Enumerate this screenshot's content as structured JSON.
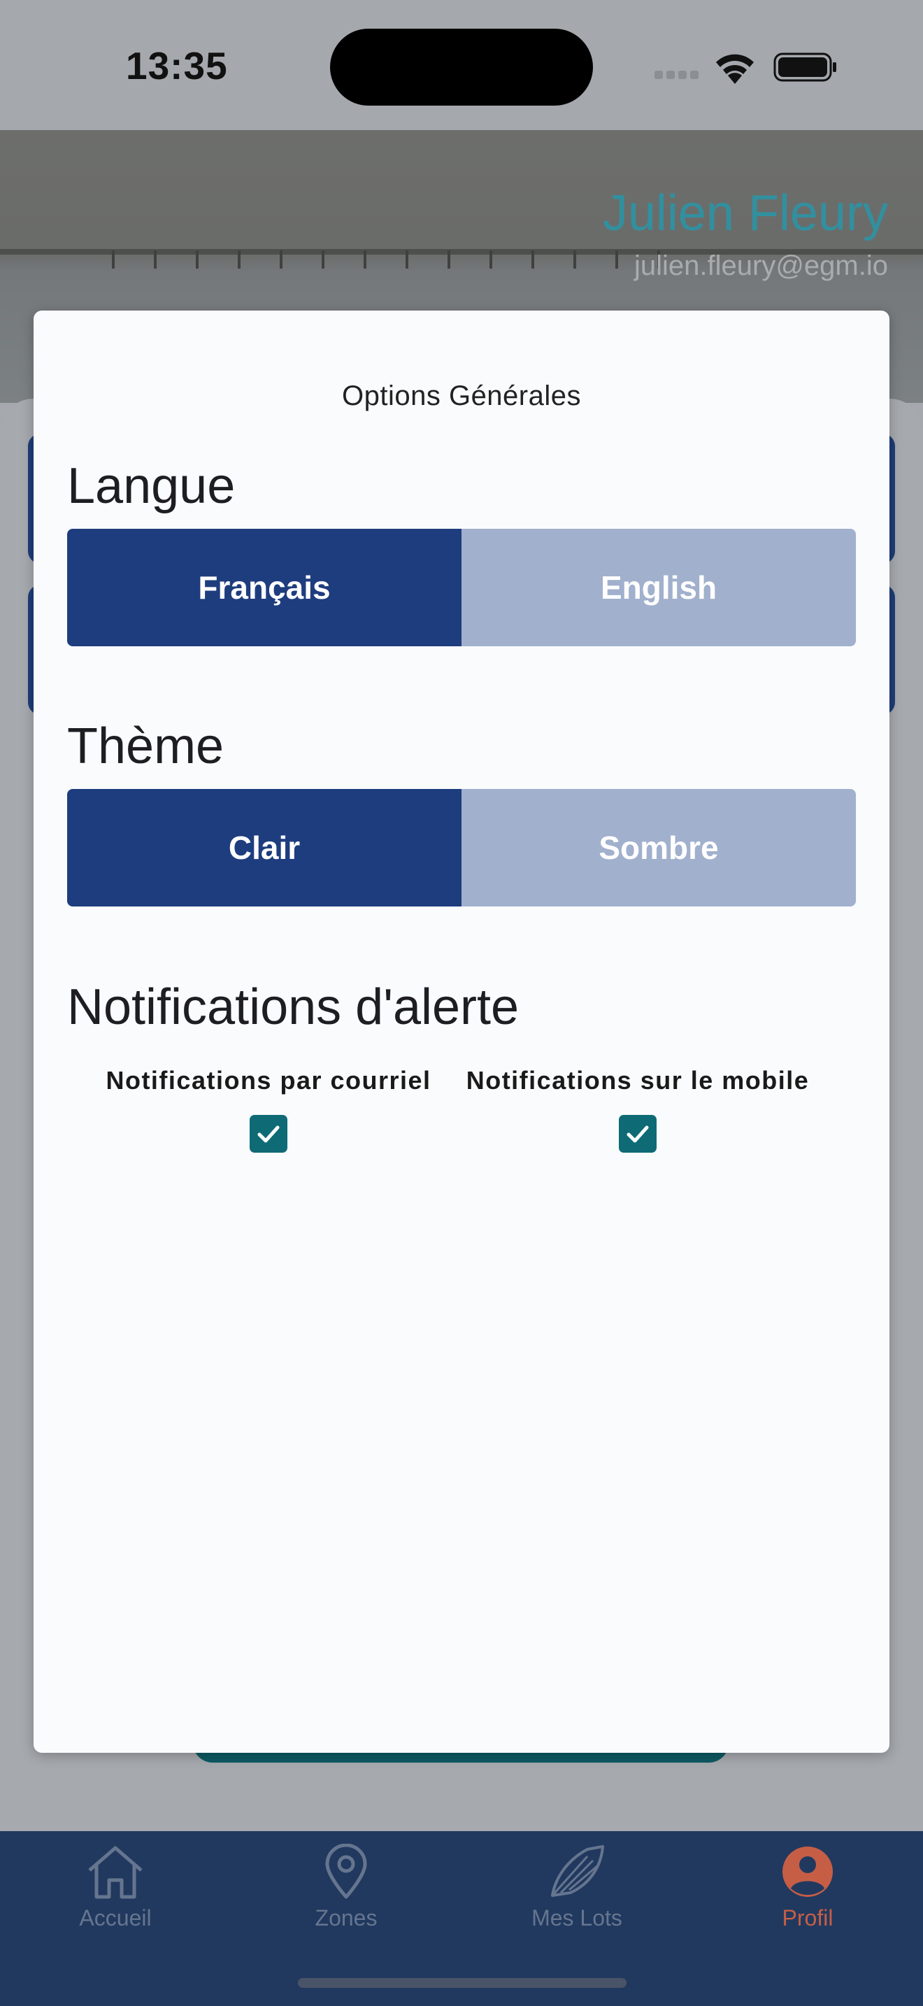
{
  "status_bar": {
    "time": "13:35"
  },
  "header": {
    "user_name": "Julien Fleury",
    "user_email": "julien.fleury@egm.io"
  },
  "modal": {
    "title": "Options Générales",
    "language": {
      "title": "Langue",
      "options": [
        "Français",
        "English"
      ],
      "selected": "Français"
    },
    "theme": {
      "title": "Thème",
      "options": [
        "Clair",
        "Sombre"
      ],
      "selected": "Clair"
    },
    "notifications": {
      "title": "Notifications d'alerte",
      "email_label": "Notifications par courriel",
      "email_checked": true,
      "mobile_label": "Notifications sur le mobile",
      "mobile_checked": true
    }
  },
  "bottom_nav": {
    "items": [
      {
        "label": "Accueil",
        "icon": "home-icon"
      },
      {
        "label": "Zones",
        "icon": "map-pin-icon"
      },
      {
        "label": "Mes Lots",
        "icon": "shell-icon"
      },
      {
        "label": "Profil",
        "icon": "profile-icon"
      }
    ],
    "active": "Profil"
  },
  "colors": {
    "primary": "#1e3d7e",
    "inactive_segment": "#a1b0cd",
    "checkbox": "#0e6b76",
    "accent_name": "#3190a0",
    "nav_active": "#c65e46",
    "nav_background": "#21395f"
  }
}
